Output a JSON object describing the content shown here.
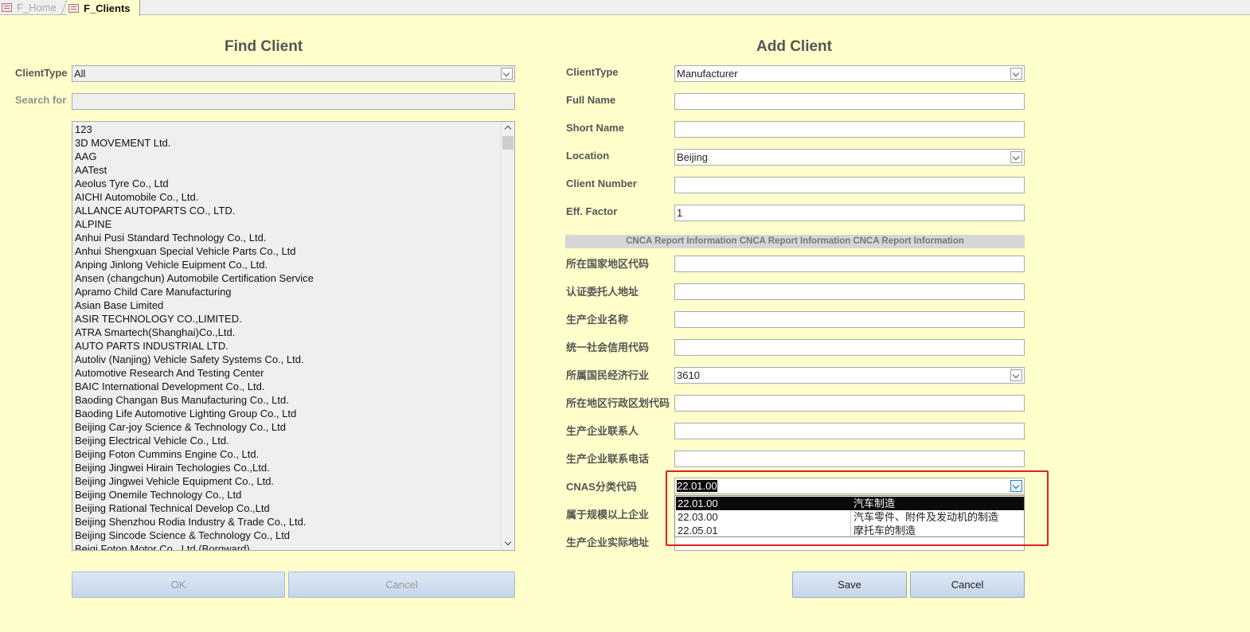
{
  "tabs": [
    {
      "label": "F_Home",
      "active": false
    },
    {
      "label": "F_Clients",
      "active": true
    }
  ],
  "find": {
    "title": "Find Client",
    "clienttype_label": "ClientType",
    "clienttype_value": "All",
    "search_label": "Search for",
    "search_value": "",
    "clients": [
      "123",
      "3D MOVEMENT Ltd.",
      "AAG",
      "AATest",
      "Aeolus Tyre Co., Ltd",
      "AICHI Automobile Co., Ltd.",
      "ALLANCE AUTOPARTS CO., LTD.",
      "ALPINE",
      "Anhui Pusi Standard Technology Co., Ltd.",
      "Anhui Shengxuan Special Vehicle Parts Co., Ltd",
      "Anping Jinlong Vehicle Euipment Co., Ltd.",
      "Ansen (changchun) Automobile Certification Service",
      "Apramo Child Care Manufacturing",
      "Asian Base Limited",
      "ASIR TECHNOLOGY CO.,LIMITED.",
      "ATRA Smartech(Shanghai)Co.,Ltd.",
      "AUTO PARTS INDUSTRIAL LTD.",
      "Autoliv (Nanjing) Vehicle Safety Systems Co., Ltd.",
      "Automotive Research And Testing Center",
      "BAIC International Development Co., Ltd.",
      "Baoding Changan Bus Manufacturing Co., Ltd.",
      "Baoding Life Automotive Lighting Group Co., Ltd",
      "Beijing Car-joy Science & Technology Co., Ltd",
      "Beijing Electrical Vehicle Co., Ltd.",
      "Beijing Foton Cummins Engine Co., Ltd.",
      "Beijing Jingwei Hirain Techologies Co.,Ltd.",
      "Beijing Jingwei Vehicle Equipment Co., Ltd.",
      "Beijing Onemile Technology Co., Ltd",
      "Beijing Rational Technical Develop Co.,Ltd",
      "Beijing Shenzhou Rodia Industry & Trade Co., Ltd.",
      "Beijing Sincode Science & Technology Co., Ltd",
      "Beiqi Foton Motor Co., Ltd.(Borgward)"
    ],
    "ok_label": "OK",
    "cancel_label": "Cancel"
  },
  "add": {
    "title": "Add Client",
    "fields": {
      "clienttype": {
        "label": "ClientType",
        "value": "Manufacturer"
      },
      "fullname": {
        "label": "Full Name",
        "value": ""
      },
      "shortname": {
        "label": "Short Name",
        "value": ""
      },
      "location": {
        "label": "Location",
        "value": "Beijing"
      },
      "clientnumber": {
        "label": "Client Number",
        "value": ""
      },
      "efffactor": {
        "label": "Eff. Factor",
        "value": "1"
      }
    },
    "cnca_header": "CNCA Report Information CNCA Report Information CNCA Report Information",
    "cnca": {
      "country": {
        "label": "所在国家地区代码",
        "value": ""
      },
      "applicant_addr": {
        "label": "认证委托人地址",
        "value": ""
      },
      "manufacturer_name": {
        "label": "生产企业名称",
        "value": ""
      },
      "credit_code": {
        "label": "统一社会信用代码",
        "value": ""
      },
      "industry": {
        "label": "所属国民经济行业",
        "value": "3610"
      },
      "region_code": {
        "label": "所在地区行政区划代码",
        "value": ""
      },
      "contact": {
        "label": "生产企业联系人",
        "value": ""
      },
      "phone": {
        "label": "生产企业联系电话",
        "value": ""
      },
      "cnas": {
        "label": "CNAS分类代码",
        "value": "22.01.00"
      },
      "scale": {
        "label": "属于规模以上企业",
        "value": ""
      },
      "actual_addr": {
        "label": "生产企业实际地址",
        "value": ""
      }
    },
    "cnas_options": [
      {
        "code": "22.01.00",
        "desc": "汽车制造"
      },
      {
        "code": "22.03.00",
        "desc": "汽车零件、附件及发动机的制造"
      },
      {
        "code": "22.05.01",
        "desc": "摩托车的制造"
      }
    ],
    "save_label": "Save",
    "cancel_label": "Cancel"
  },
  "colors": {
    "background": "#ffffcc",
    "highlight_box": "#e02020",
    "selection": "#0a0a0a"
  }
}
